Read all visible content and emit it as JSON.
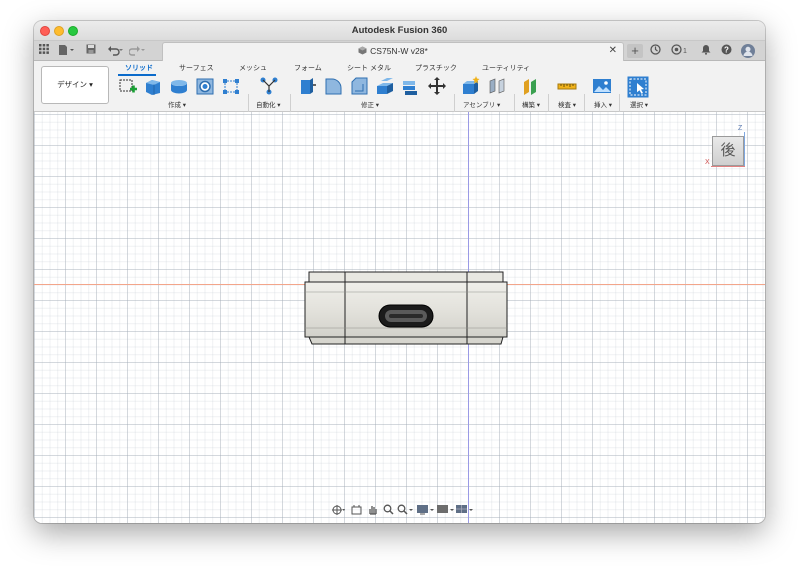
{
  "app": {
    "window_title": "Autodesk Fusion 360"
  },
  "document_tab": {
    "title": "CS75N-W v28*"
  },
  "tabbar": {
    "notification_count": "1"
  },
  "ribbon": {
    "workspace": "デザイン ▾",
    "tabs": [
      "ソリッド",
      "サーフェス",
      "メッシュ",
      "フォーム",
      "シート メタル",
      "プラスチック",
      "ユーティリティ"
    ],
    "active_tab": "ソリッド",
    "groups": [
      {
        "label": "作成 ▾"
      },
      {
        "label": "自動化 ▾"
      },
      {
        "label": "修正 ▾"
      },
      {
        "label": "アセンブリ ▾"
      },
      {
        "label": "構築 ▾"
      },
      {
        "label": "検査 ▾"
      },
      {
        "label": "挿入 ▾"
      },
      {
        "label": "選択 ▾"
      }
    ]
  },
  "viewcube": {
    "face_label": "後",
    "axis_z": "Z",
    "axis_x": "X"
  },
  "colors": {
    "accent": "#0b6bcb",
    "model_body": "#e3e2dc",
    "x_axis": "#f3a58a",
    "z_axis": "#9a9ae6"
  }
}
